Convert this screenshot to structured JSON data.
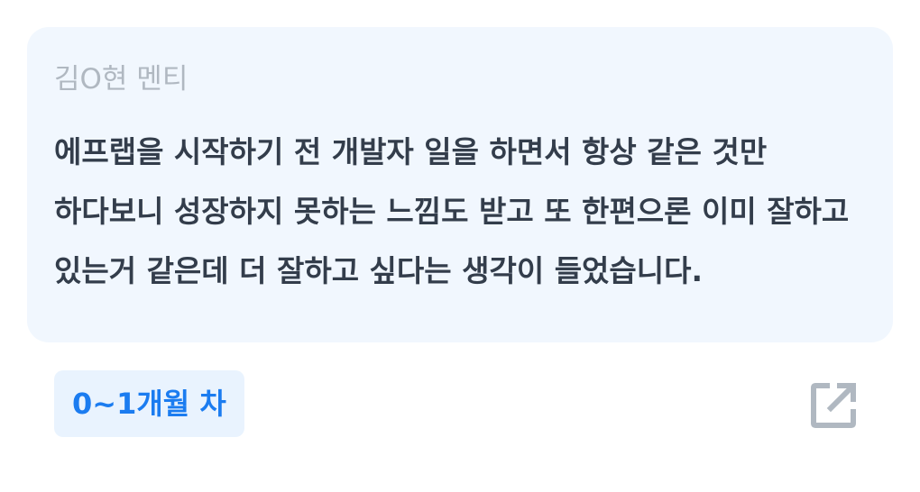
{
  "review": {
    "mentor_name": "김O현 멘티",
    "quote": "에프랩을 시작하기 전 개발자 일을 하면서 항상 같은 것만 하다보니 성장하지 못하는 느낌도 받고 또 한편으론 이미 잘하고 있는거 같은데 더 잘하고 싶다는 생각이 들었습니다."
  },
  "tag": {
    "label": "0~1개월 차",
    "color": "#1b7cf0",
    "background": "#e9f3fe"
  },
  "actions": {
    "open_icon": "external-link-icon"
  },
  "colors": {
    "card_background": "#f1f7fe",
    "name_text": "#b0b8c1",
    "quote_text": "#333d4b",
    "icon": "#b0b8c1"
  }
}
